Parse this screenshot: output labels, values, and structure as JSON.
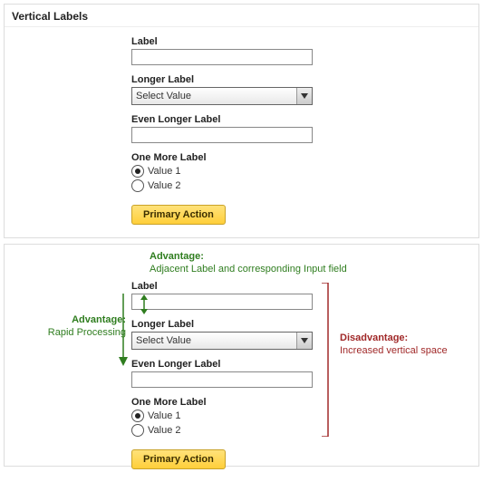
{
  "header": {
    "title": "Vertical Labels"
  },
  "form": {
    "label1": "Label",
    "label2": "Longer Label",
    "select_value": "Select Value",
    "label3": "Even Longer Label",
    "label4": "One More Label",
    "radio1": "Value 1",
    "radio2": "Value 2",
    "primary": "Primary Action"
  },
  "anno": {
    "top_title": "Advantage:",
    "top_text": "Adjacent Label and corresponding Input field",
    "left_title": "Advantage:",
    "left_text": "Rapid Processing",
    "right_title": "Disadvantage:",
    "right_text": "Increased vertical space"
  }
}
